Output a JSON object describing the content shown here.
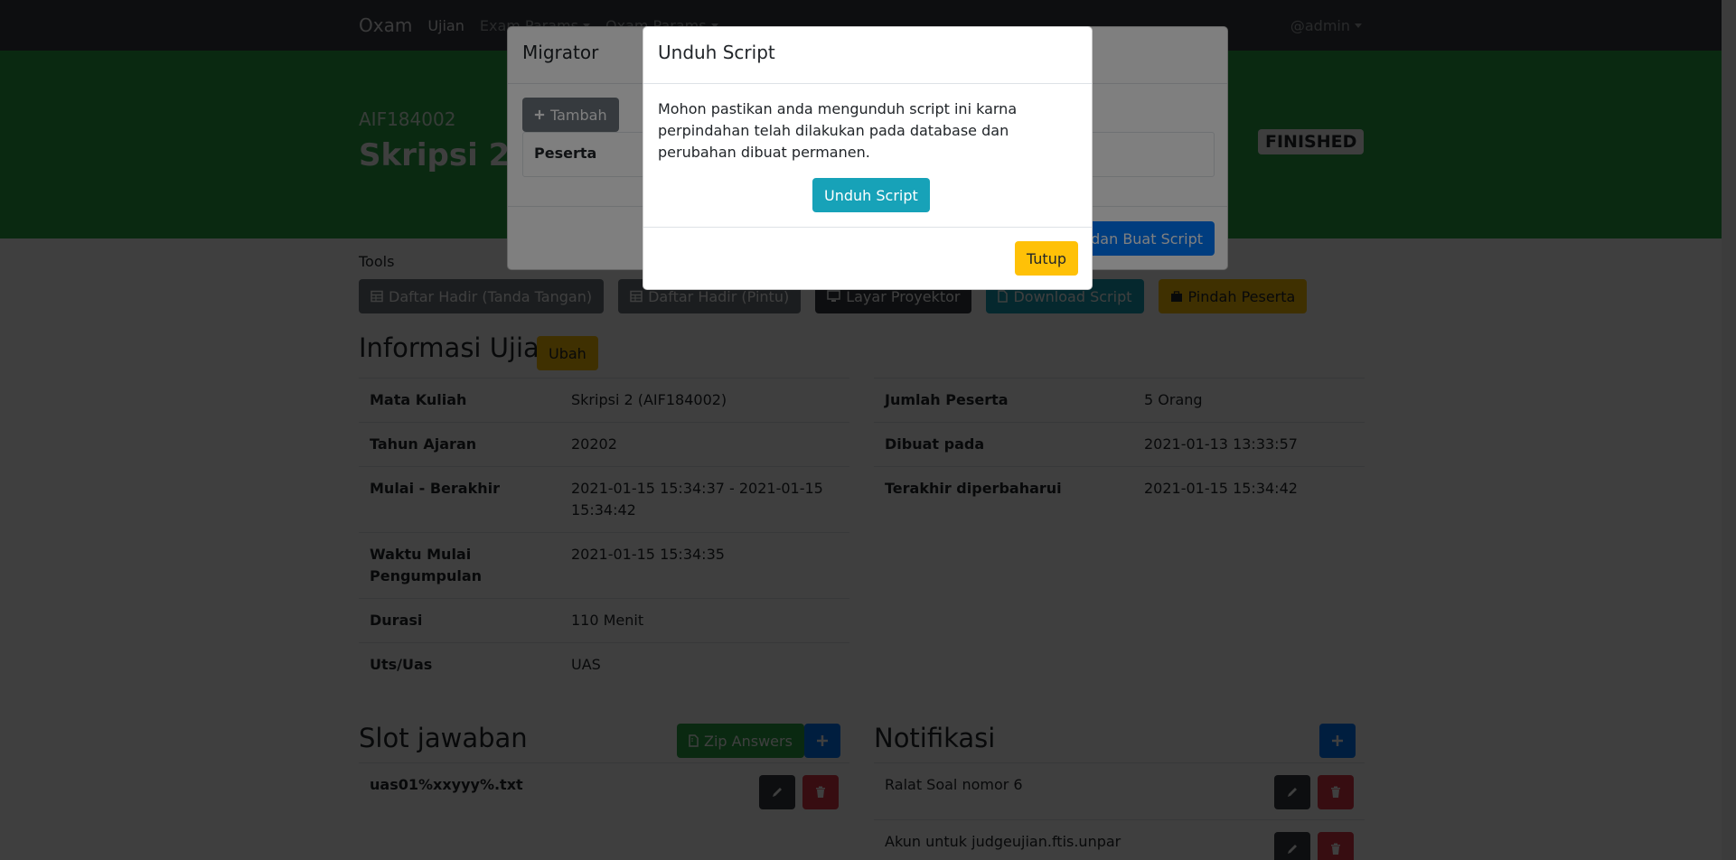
{
  "navbar": {
    "brand": "Oxam",
    "links": [
      "Ujian",
      "Exam Params",
      "Oxam Params"
    ],
    "user": "@admin"
  },
  "hero": {
    "code": "AIF184002",
    "title": "Skripsi 2",
    "status": "FINISHED"
  },
  "tools": {
    "label": "Tools",
    "buttons": [
      "Daftar Hadir (Tanda Tangan)",
      "Daftar Hadir (Pintu)",
      "Layar Proyektor",
      "Download Script",
      "Pindah Peserta"
    ]
  },
  "info": {
    "title": "Informasi Ujian",
    "edit_label": "Ubah",
    "left": [
      {
        "key": "Mata Kuliah",
        "value": "Skripsi 2 (AIF184002)"
      },
      {
        "key": "Tahun Ajaran",
        "value": "20202"
      },
      {
        "key": "Mulai - Berakhir",
        "value": "2021-01-15 15:34:37 - 2021-01-15 15:34:42"
      },
      {
        "key": "Waktu Mulai Pengumpulan",
        "value": "2021-01-15 15:34:35"
      },
      {
        "key": "Durasi",
        "value": "110 Menit"
      },
      {
        "key": "Uts/Uas",
        "value": "UAS"
      }
    ],
    "right": [
      {
        "key": "Jumlah Peserta",
        "value": "5 Orang"
      },
      {
        "key": "Dibuat pada",
        "value": "2021-01-13 13:33:57"
      },
      {
        "key": "Terakhir diperbaharui",
        "value": "2021-01-15 15:34:42"
      }
    ]
  },
  "slots": {
    "title": "Slot jawaban",
    "zip_label": "Zip Answers",
    "items": [
      "uas01%xxyyy%.txt"
    ]
  },
  "notifications": {
    "title": "Notifikasi",
    "items": [
      "Ralat Soal nomor 6",
      "Akun untuk judgeujian.ftis.unpar"
    ]
  },
  "migrator": {
    "title": "Migrator",
    "add_label": "Tambah",
    "column_header": "Peserta",
    "submit_label": "Pindahkan dan Buat Script"
  },
  "download_modal": {
    "title": "Unduh Script",
    "message": "Mohon pastikan anda mengunduh script ini karna perpindahan telah dilakukan pada database dan perubahan dibuat permanen.",
    "download_label": "Unduh Script",
    "close_label": "Tutup"
  },
  "colors": {
    "navbar": "#343a40",
    "hero": "#28a745",
    "primary": "#007bff",
    "info": "#17a2b8",
    "warning": "#ffc107",
    "danger": "#dc3545"
  }
}
